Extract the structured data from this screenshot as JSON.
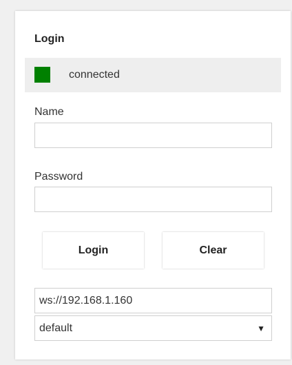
{
  "panel": {
    "title": "Login"
  },
  "status": {
    "text": "connected",
    "color": "#008000"
  },
  "form": {
    "name_label": "Name",
    "name_value": "",
    "password_label": "Password",
    "password_value": ""
  },
  "buttons": {
    "login_label": "Login",
    "clear_label": "Clear"
  },
  "server": {
    "url_value": "ws://192.168.1.160"
  },
  "profile_select": {
    "selected": "default",
    "arrow_icon": "triangle-down-icon"
  }
}
